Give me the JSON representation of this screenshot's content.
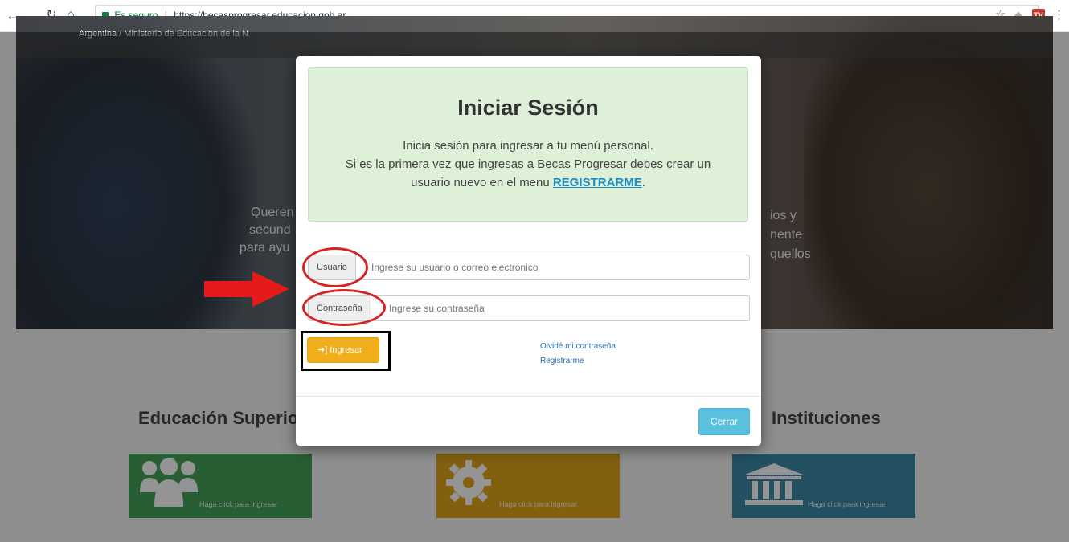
{
  "browser": {
    "secure_label": "Es seguro",
    "url": "https://becasprogresar.educacion.gob.ar",
    "ext_label": "TV"
  },
  "hero": {
    "bc_1": "Argentina",
    "bc_sep": "/",
    "bc_2": "Ministerio de Educación de la N",
    "text_left_1": "Queren",
    "text_left_2": "secund",
    "text_left_3": "para ayu",
    "text_right_1": "ios y",
    "text_right_2": "nente",
    "text_right_3": "quellos"
  },
  "sections": {
    "left_title": "Educación Superio",
    "right_title": "Instituciones"
  },
  "cards": {
    "card_1": {
      "label": "Haga click para ingresar",
      "color": "#46a35a"
    },
    "card_2": {
      "label": "Haga click para ingresar",
      "color": "#e1a51c"
    },
    "card_3": {
      "label": "Haga click para ingresar",
      "color": "#3b8aa8"
    }
  },
  "modal": {
    "title": "Iniciar Sesión",
    "line_1": "Inicia sesión para ingresar a tu menú personal.",
    "line_2": "Si es la primera vez que ingresas a Becas Progresar debes crear un",
    "line_3_pre": "usuario nuevo en el menu",
    "register_link": "REGISTRARME",
    "line_3_post": ".",
    "user_label": "Usuario",
    "user_placeholder": "Ingrese su usuario o correo electrónico",
    "pass_label": "Contraseña",
    "pass_placeholder": "Ingrese su contraseña",
    "login_button": "Ingresar",
    "forgot_link": "Olvidé mi contraseña",
    "register_link_2": "Registrarme",
    "close_button": "Cerrar"
  },
  "colors": {
    "annotation_red": "#d62323",
    "login_button": "#f0ad1c",
    "close_button": "#5bc0de"
  }
}
